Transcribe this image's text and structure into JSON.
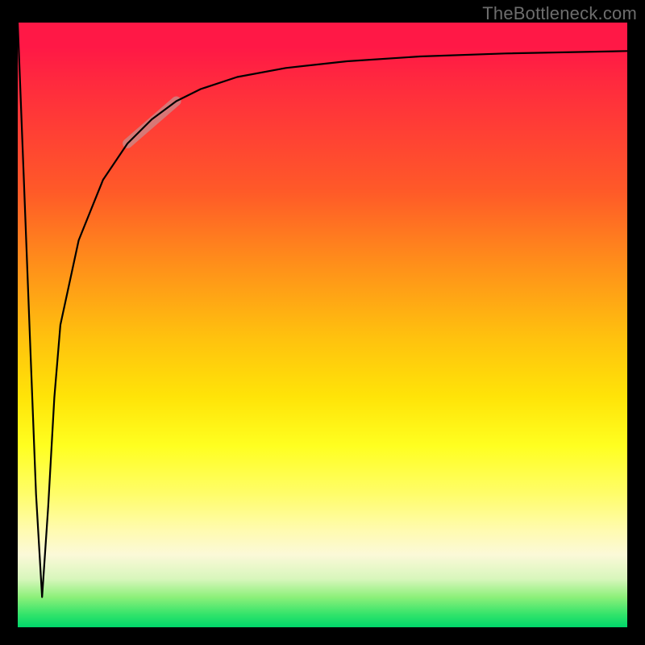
{
  "watermark": "TheBottleneck.com",
  "chart_data": {
    "type": "line",
    "title": "",
    "xlabel": "",
    "ylabel": "",
    "xlim": [
      0,
      100
    ],
    "ylim": [
      0,
      100
    ],
    "grid": false,
    "legend": false,
    "series": [
      {
        "name": "curve",
        "x": [
          0,
          1,
          2,
          3,
          4,
          5,
          6,
          7,
          10,
          14,
          18,
          22,
          26,
          30,
          36,
          44,
          54,
          66,
          80,
          100
        ],
        "y": [
          100,
          74,
          48,
          22,
          5,
          20,
          38,
          50,
          64,
          74,
          80,
          84,
          87,
          89,
          91,
          92.5,
          93.6,
          94.4,
          94.9,
          95.3
        ]
      }
    ],
    "highlight_segment": {
      "x_start": 18,
      "x_end": 26
    },
    "background_gradient": {
      "top": "#ff1846",
      "mid": "#ffff20",
      "bottom": "#00d66a"
    }
  }
}
